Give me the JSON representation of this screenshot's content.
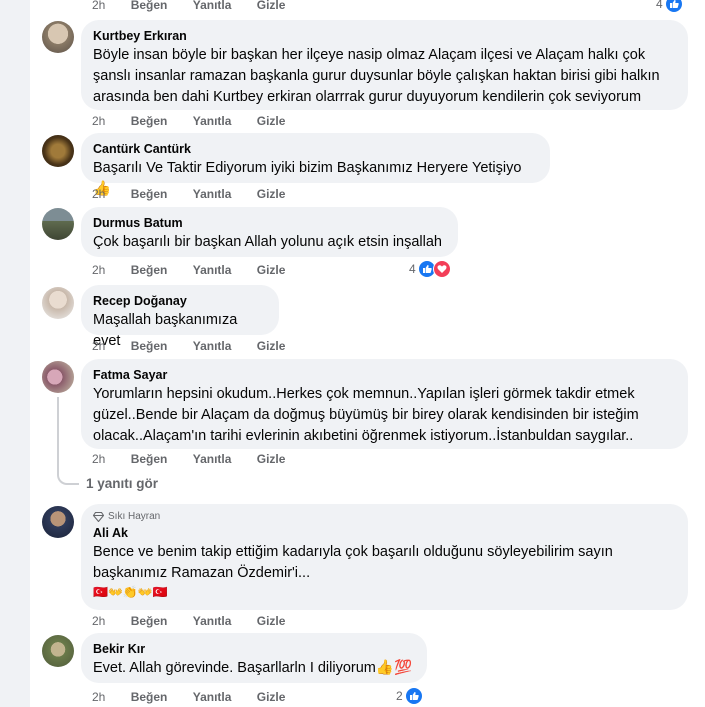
{
  "actions": {
    "time": "2h",
    "like": "Beğen",
    "reply": "Yanıtla",
    "hide": "Gizle"
  },
  "top_row": {
    "reaction_count": "4"
  },
  "comments": [
    {
      "author": "Kurtbey Erkıran",
      "text": "Böyle insan böyle bir başkan her ilçeye nasip olmaz Alaçam ilçesi ve Alaçam halkı çok şanslı insanlar ramazan başkanla gurur duysunlar böyle çalışkan haktan birisi gibi halkın arasında ben dahi Kurtbey erkiran olarrrak gurur duyuyorum kendilerin çok seviyorum"
    },
    {
      "author": "Cantürk Cantürk",
      "text": "Başarılı Ve Taktir Ediyorum iyiki bizim Başkanımız Heryere Yetişiyo👍"
    },
    {
      "author": "Durmus Batum",
      "text": "Çok başarılı bir başkan Allah yolunu açık etsin inşallah",
      "reaction_count": "4"
    },
    {
      "author": "Recep Doğanay",
      "text": "Maşallah başkanımıza evet"
    },
    {
      "author": "Fatma Sayar",
      "text": "Yorumların hepsini okudum..Herkes çok memnun..Yapılan işleri görmek takdir etmek güzel..Bende bir Alaçam da doğmuş büyümüş bir birey olarak kendisinden bir isteğim olacak..Alaçam'ın tarihi evlerinin akıbetini öğrenmek istiyorum..İstanbuldan saygılar..",
      "replies_link": "1 yanıtı gör"
    },
    {
      "author": "Ali Ak",
      "badge": "Sıkı Hayran",
      "text": "Bence ve benim takip ettiğim kadarıyla çok başarılı olduğunu söyleyebilirim sayın başkanımız Ramazan Özdemir'i...",
      "emoji_line": "🇹🇷👐👏👐🇹🇷"
    },
    {
      "author": "Bekir Kır",
      "text": "Evet. Allah görevinde. Başarllarln I diliyorum👍💯",
      "reaction_count": "2"
    }
  ],
  "colors": {
    "bubble": "#f0f2f5",
    "meta": "#65676b",
    "like": "#1877f2",
    "love": "#f33e58"
  }
}
